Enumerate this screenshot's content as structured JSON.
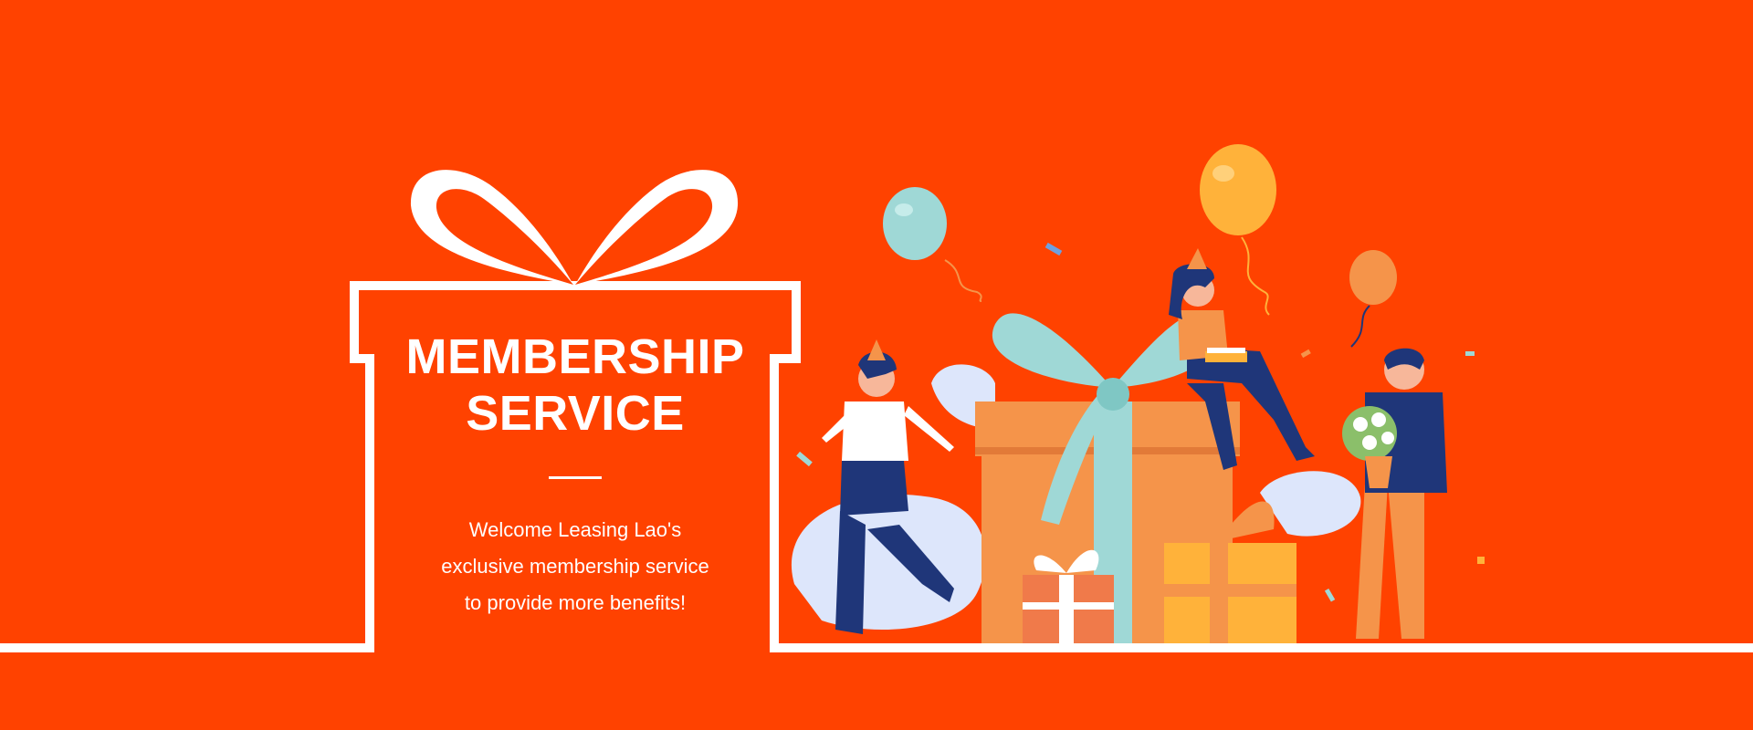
{
  "hero": {
    "title_line1": "MEMBERSHIP",
    "title_line2": "SERVICE",
    "description_lines": [
      "Welcome Leasing Lao's",
      "exclusive membership service",
      "to provide more benefits!"
    ]
  },
  "colors": {
    "background": "#ff4200",
    "line": "#ffffff",
    "teal": "#9fd8d6",
    "navy": "#1f3679",
    "gift_orange": "#f5944a",
    "gift_yellow": "#ffb23a",
    "leaf": "#dde6fb"
  },
  "icons": [
    "gift-outline-icon",
    "ribbon-bow-icon",
    "balloon-icon",
    "gift-box-icon"
  ]
}
